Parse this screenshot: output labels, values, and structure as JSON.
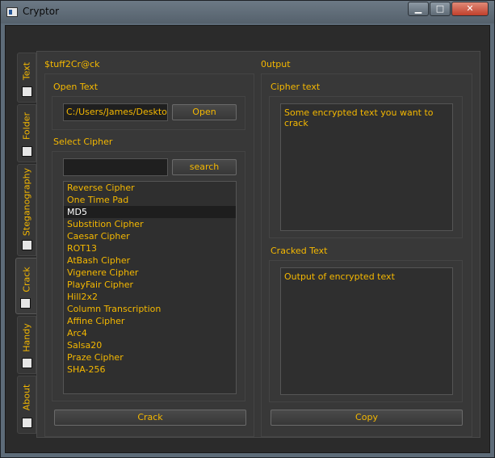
{
  "window": {
    "title": "Cryptor",
    "min_glyph": "▁",
    "max_glyph": "□",
    "close_glyph": "✕"
  },
  "tabs": [
    {
      "label": "Text",
      "icon": "text-icon"
    },
    {
      "label": "Folder",
      "icon": "folder-icon"
    },
    {
      "label": "Steganography",
      "icon": "image-icon"
    },
    {
      "label": "Crack",
      "icon": "crack-icon",
      "active": true
    },
    {
      "label": "Handy",
      "icon": "handy-icon"
    },
    {
      "label": "About",
      "icon": "about-icon"
    }
  ],
  "left_panel": {
    "title": "$tuff2Cr@ck",
    "open_text": {
      "group_title": "Open Text",
      "path": "C:/Users/James/Desktop/",
      "open_label": "Open"
    },
    "select_cipher": {
      "group_title": "Select Cipher",
      "search_value": "",
      "search_label": "search",
      "items": [
        "Reverse Cipher",
        "One Time Pad",
        "MD5",
        "Substition Cipher",
        "Caesar Cipher",
        "ROT13",
        "AtBash Cipher",
        "Vigenere Cipher",
        "PlayFair Cipher",
        "Hill2x2",
        "Column Transcription",
        "Affine Cipher",
        "Arc4",
        "Salsa20",
        "Praze Cipher",
        "SHA-256"
      ],
      "selected_index": 2
    },
    "crack_label": "Crack"
  },
  "right_panel": {
    "title": "0utput",
    "cipher_text": {
      "group_title": "Cipher text",
      "value": "Some encrypted text you want to crack"
    },
    "cracked_text": {
      "group_title": "Cracked Text",
      "value": "Output of encrypted text"
    },
    "copy_label": "Copy"
  },
  "colors": {
    "accent": "#f5b800",
    "background": "#2b2b2b",
    "panel": "#383838"
  }
}
